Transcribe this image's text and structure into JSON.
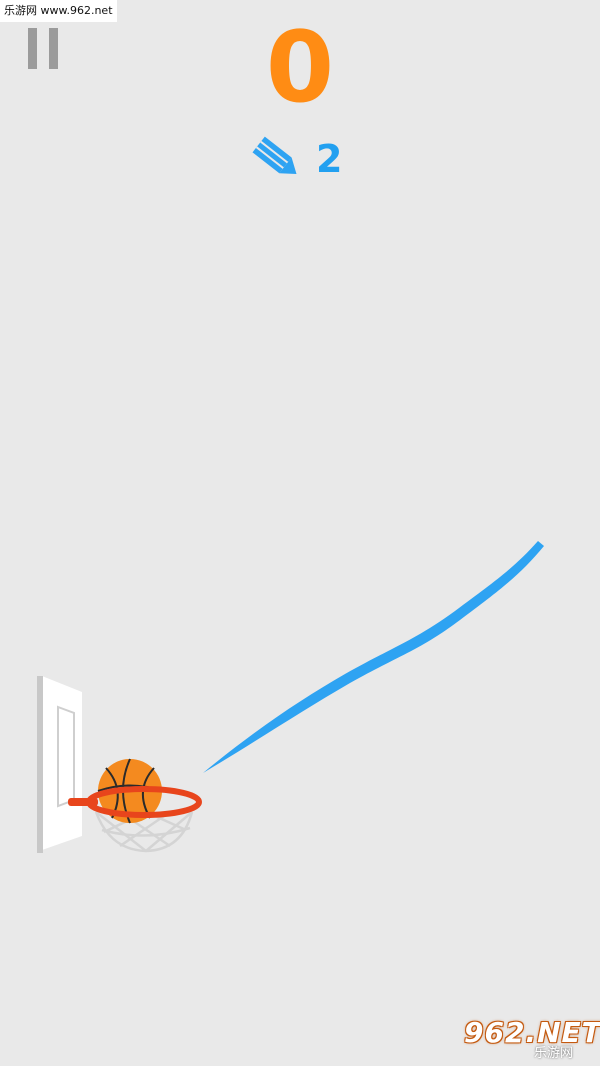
{
  "watermark_top": "乐游网 www.962.net",
  "hud": {
    "pause_icon": "pause-icon",
    "score": "0",
    "pencil_icon": "pencil-icon",
    "pencils_left": "2"
  },
  "scene": {
    "ball_icon": "basketball-icon",
    "hoop_icon": "hoop-icon",
    "backboard_icon": "backboard-icon"
  },
  "watermark_bottom": {
    "brand": "962.NET",
    "sub": "乐游网"
  },
  "colors": {
    "background": "#e9e9e9",
    "score": "#ff8c14",
    "line": "#2ea3f2",
    "rim": "#e8451c",
    "ball": "#f48a1f"
  }
}
